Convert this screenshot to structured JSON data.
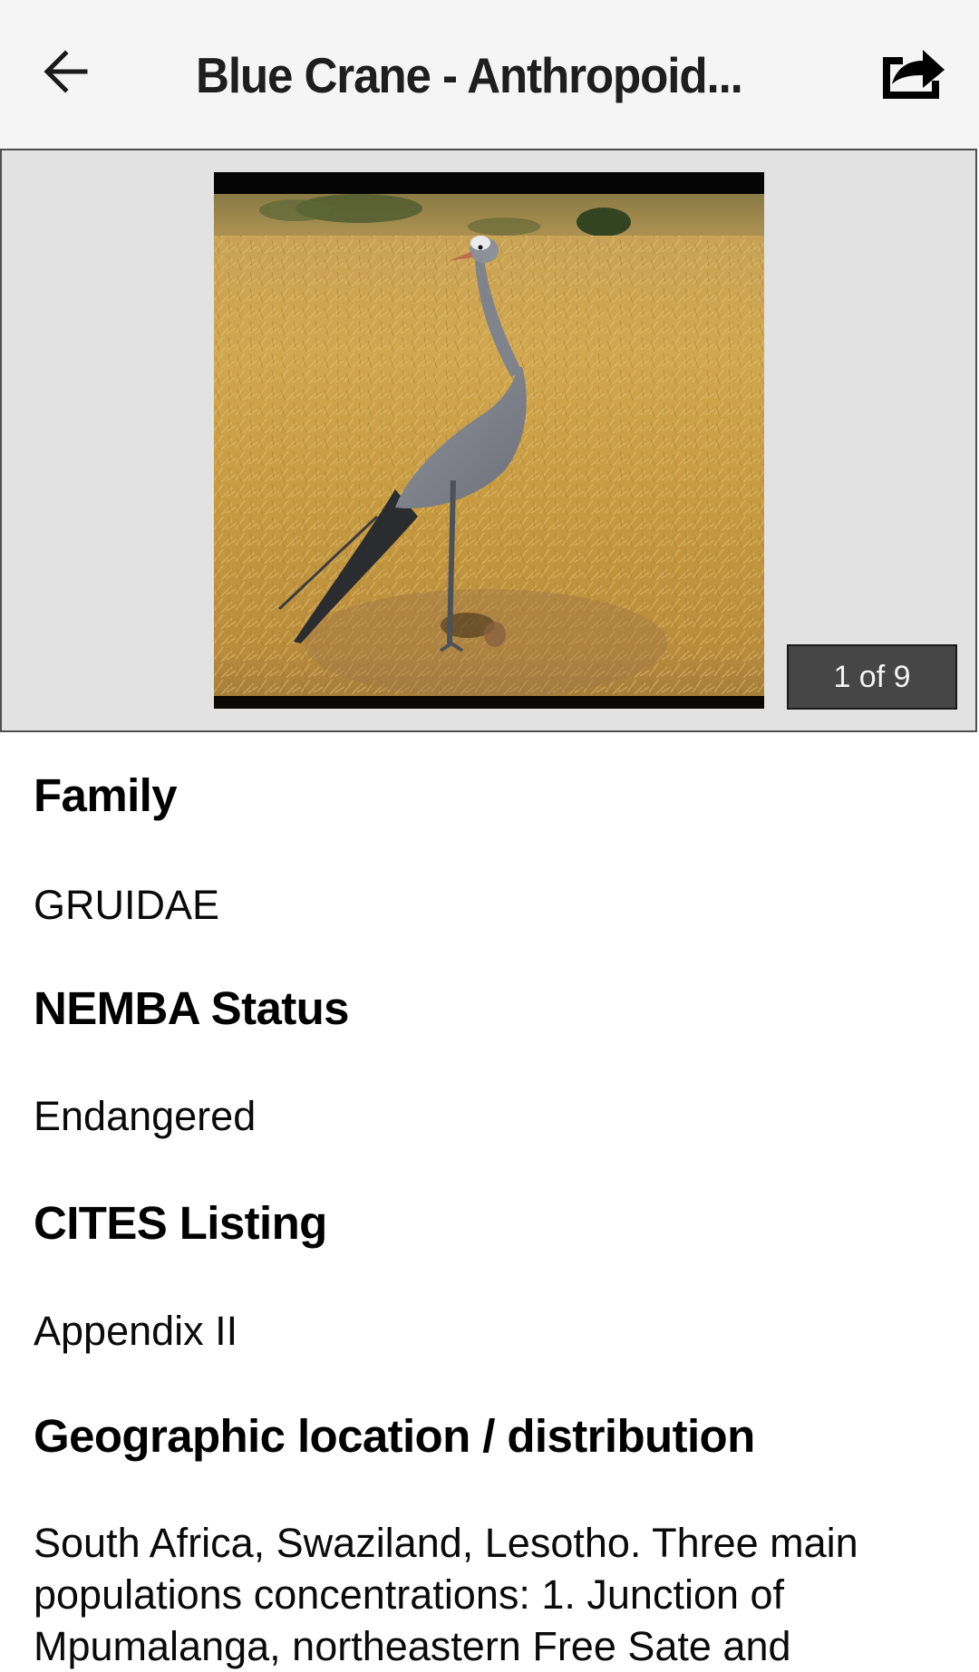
{
  "header": {
    "back_icon": "arrow-left-icon",
    "title": "Blue Crane - Anthropoid...",
    "share_icon": "share-icon"
  },
  "gallery": {
    "image_alt": "Blue crane standing in dry golden grass field",
    "counter": "1 of 9",
    "current_index": 1,
    "total_images": 9
  },
  "sections": [
    {
      "heading": "Family",
      "value": "GRUIDAE"
    },
    {
      "heading": "NEMBA Status",
      "value": "Endangered"
    },
    {
      "heading": "CITES Listing",
      "value": "Appendix II"
    },
    {
      "heading": "Geographic location / distribution",
      "value_lines": [
        "South Africa, Swaziland, Lesotho. Three main",
        "populations concentrations: 1. Junction of",
        "Mpumalanga, northeastern Free Sate and"
      ]
    }
  ],
  "colors": {
    "header_bg": "#f5f5f5",
    "gallery_bg": "#e2e2e2",
    "counter_bg": "#464646",
    "text": "#000000"
  }
}
